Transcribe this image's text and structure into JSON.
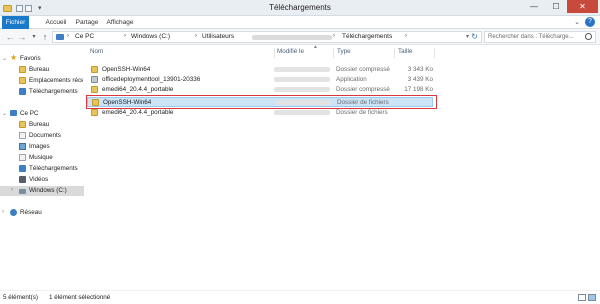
{
  "window": {
    "title": "Téléchargements",
    "controls": {
      "minimize": "—",
      "maximize": "☐",
      "close": "✕"
    }
  },
  "ribbon": {
    "tabs": [
      "Fichier",
      "Accueil",
      "Partage",
      "Affichage"
    ],
    "help": "?"
  },
  "address": {
    "crumbs": [
      "Ce PC",
      "Windows (C:)",
      "Utilisateurs",
      "Téléchargements"
    ],
    "search_placeholder": "Rechercher dans : Télécharge..."
  },
  "nav": {
    "favorites_label": "Favoris",
    "favorites": [
      "Bureau",
      "Emplacements récents",
      "Téléchargements"
    ],
    "pc_label": "Ce PC",
    "pc_items": [
      "Bureau",
      "Documents",
      "Images",
      "Musique",
      "Téléchargements",
      "Vidéos",
      "Windows (C:)"
    ],
    "network_label": "Réseau"
  },
  "columns": {
    "name": "Nom",
    "modified": "Modifié le",
    "type": "Type",
    "size": "Taille"
  },
  "files": [
    {
      "name": "OpenSSH-Win64",
      "type": "Dossier compressé",
      "size": "3 343 Ko",
      "icon": "zip-folder-icon"
    },
    {
      "name": "officedeploymenttool_13901-20336",
      "type": "Application",
      "size": "3 439 Ko",
      "icon": "application-icon"
    },
    {
      "name": "emedi64_20.4.4_portable",
      "type": "Dossier compressé",
      "size": "17 198 Ko",
      "icon": "zip-folder-icon"
    },
    {
      "name": "OpenSSH-Win64",
      "type": "Dossier de fichiers",
      "size": "",
      "icon": "folder-icon"
    },
    {
      "name": "emedi64_20.4.4_portable",
      "type": "Dossier de fichiers",
      "size": "",
      "icon": "folder-icon"
    }
  ],
  "status": {
    "count": "5 élément(s)",
    "selected": "1 élément sélectionné"
  },
  "colors": {
    "accent": "#1979ca",
    "selection": "#cce4f7",
    "highlight_box": "#e0343c",
    "close": "#c74a3d"
  }
}
